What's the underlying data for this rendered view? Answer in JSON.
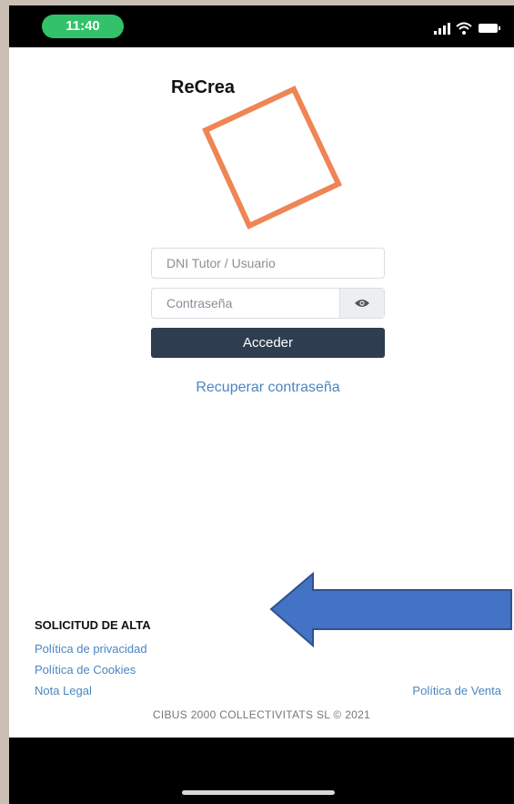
{
  "status_bar": {
    "time": "11:40"
  },
  "header": {
    "brand": "ReCrea"
  },
  "login": {
    "username_placeholder": "DNI Tutor / Usuario",
    "password_placeholder": "Contraseña",
    "submit_label": "Acceder",
    "recover_label": "Recuperar contraseña"
  },
  "footer": {
    "signup_label": "SOLICITUD DE ALTA",
    "privacy_label": "Política de privacidad",
    "cookies_label": "Política de Cookies",
    "legal_label": "Nota Legal",
    "sales_label": "Política de Venta",
    "copyright": "CIBUS 2000 COLLECTIVITATS SL © 2021"
  },
  "colors": {
    "logo_outline": "#ef8555",
    "arrow": "#4472c4",
    "arrow_border": "#2f528f",
    "button": "#2e3d4f",
    "link": "#4b86c0",
    "status_pill": "#31c26a"
  },
  "icons": [
    "signal-icon",
    "wifi-icon",
    "battery-icon",
    "eye-icon"
  ]
}
